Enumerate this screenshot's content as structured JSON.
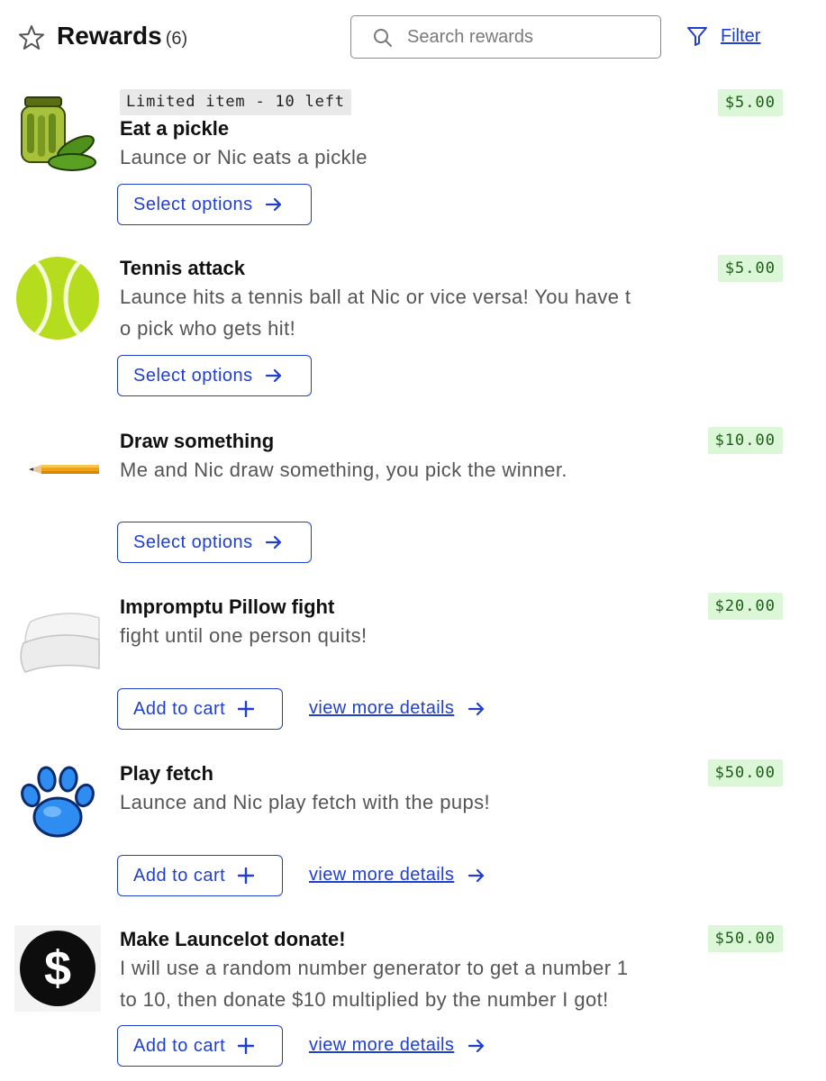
{
  "header": {
    "title": "Rewards",
    "count": "(6)",
    "search_placeholder": "Search rewards",
    "filter_label": "Filter"
  },
  "colors": {
    "accent": "#1f3fd1",
    "price_bg": "#dcf6d8",
    "price_text": "#1d5e17",
    "badge_bg": "#e9e9e9"
  },
  "items": [
    {
      "badge": "Limited item - 10 left",
      "name": "Eat a pickle",
      "description": "Launce or Nic eats a pickle",
      "price": "$5.00",
      "button": "Select options",
      "icon": "pickle-jar-icon"
    },
    {
      "name": "Tennis attack",
      "description_lines": [
        "Launce hits a tennis ball at Nic or vice versa! You have t",
        "o pick who gets hit!"
      ],
      "price": "$5.00",
      "button": "Select options",
      "icon": "tennis-ball-icon"
    },
    {
      "name": "Draw something",
      "description": "Me and Nic draw something, you pick the winner.",
      "price": "$10.00",
      "button": "Select options",
      "icon": "pencil-icon"
    },
    {
      "name": "Impromptu Pillow fight",
      "description": "fight until one person quits!",
      "price": "$20.00",
      "button": "Add to cart",
      "link": "view more details",
      "icon": "pillow-icon"
    },
    {
      "name": "Play fetch",
      "description": "Launce and Nic play fetch with the pups!",
      "price": "$50.00",
      "button": "Add to cart",
      "link": "view more details",
      "icon": "paw-print-icon"
    },
    {
      "name": "Make Launcelot donate!",
      "description_lines": [
        "I will use a random number generator to get a number 1",
        "to 10, then donate $10 multiplied by the number I got!"
      ],
      "price": "$50.00",
      "button": "Add to cart",
      "link": "view more details",
      "icon": "dollar-sign-icon"
    }
  ]
}
